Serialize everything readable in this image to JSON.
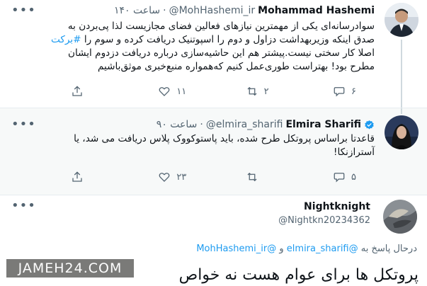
{
  "tweets": [
    {
      "name": "Mohammad Hashemi",
      "handle": "@MohHashemi_ir",
      "time": "۱۴۰ ساعت",
      "lines": [
        "سوادرسانه‌ای یکی از مهمترین نیازهای فعالین فضای مجازیست لذا پی‌بردن به",
        "صدق اینکه وزیربهداشت دزاول و دوم را اسپوتنیک دریافت کرده و سوم را",
        "اصلا کار سختی نیست.پیشتر هم این حاشیه‌سازی درباره دریافت دزدوم ایشان",
        "مطرح بود! بهتراست طوری‌عمل کنیم که‌همواره منبع‌خبری موثق‌باشیم"
      ],
      "hashtag": "#برکت",
      "replies": "۶",
      "retweets": "۲",
      "likes": "۱۱"
    },
    {
      "name": "Elmira Sharifi",
      "handle": "@elmira_sharifi",
      "time": "۹۰ ساعت",
      "lines": [
        "قاعدتا براساس پروتکل طرح شده، باید پاستوکووک پلاس دریافت می شد، یا",
        "آسترازنکا!"
      ],
      "replies": "۵",
      "retweets": "",
      "likes": "۲۳"
    }
  ],
  "reply": {
    "name": "Nightknight",
    "handle": "@Nightkn20234362",
    "replying_prefix": "درحال پاسخ به",
    "mention1": "@elmira_sharifi",
    "conj": "و",
    "mention2": "@MohHashemi_ir",
    "text": "پروتکل ها برای عوام هست نه خواص"
  },
  "more_icon": "more-dots-icon",
  "watermark": "JAMEH24.COM",
  "colors": {
    "link": "#1d9bf0",
    "muted": "#536471",
    "verified": "#1d9bf0"
  }
}
